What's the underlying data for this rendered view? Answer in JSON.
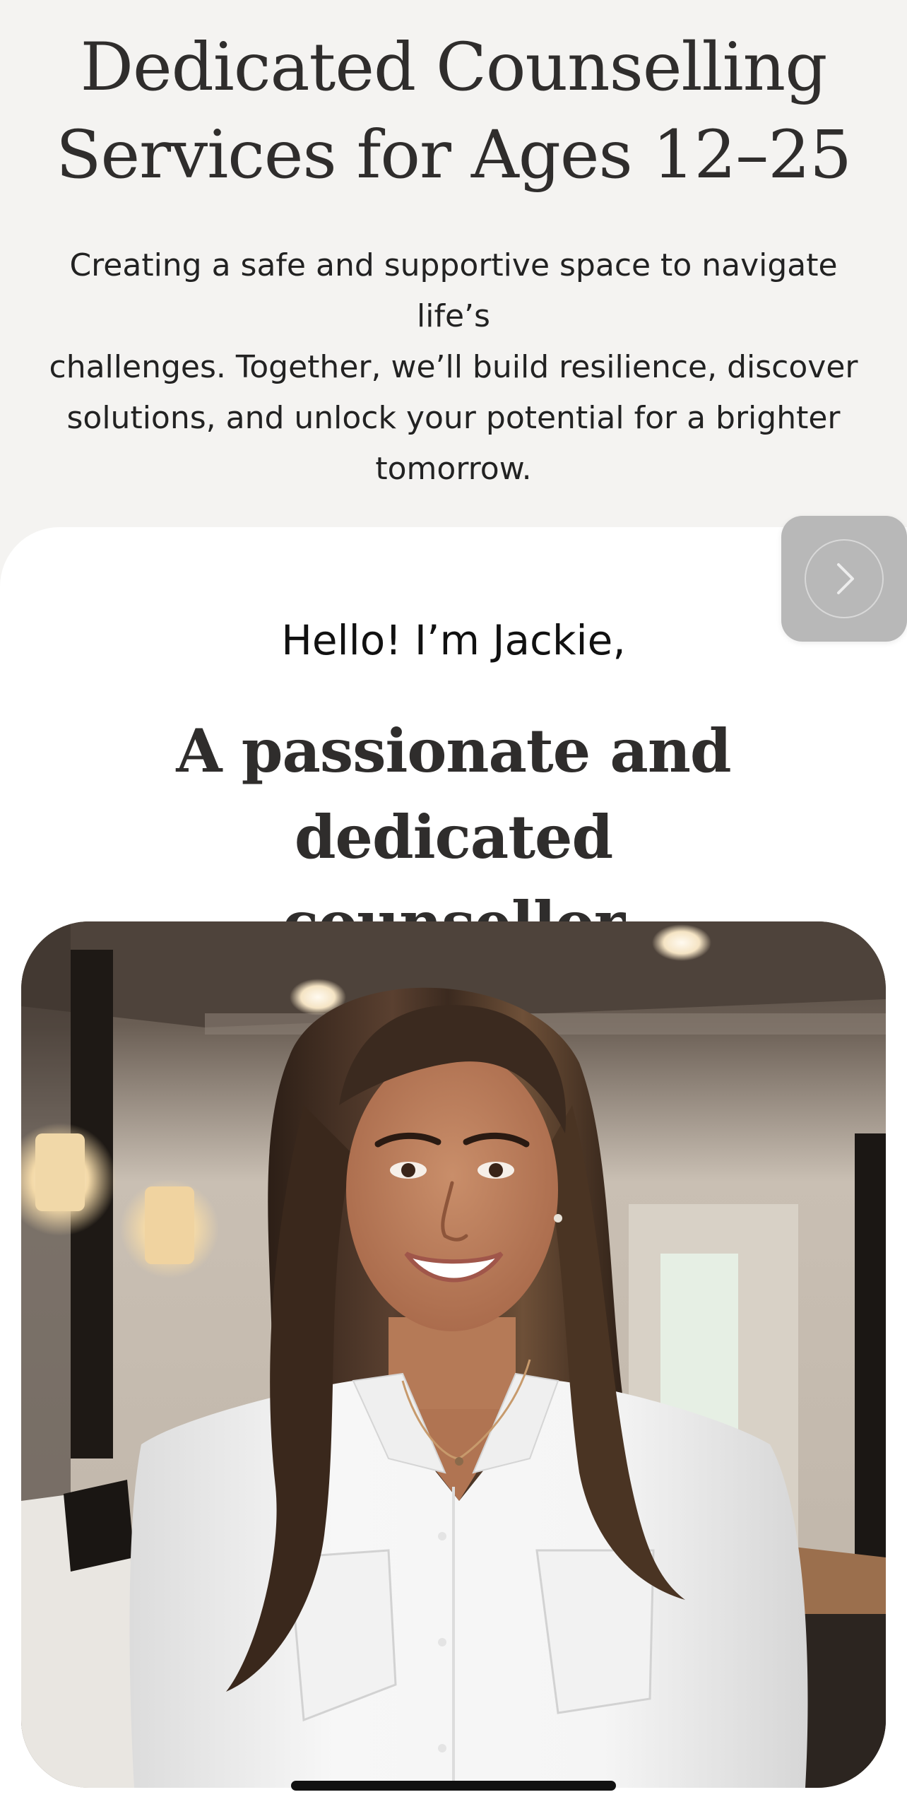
{
  "hero": {
    "title_line1": "Dedicated Counselling",
    "title_line2": "Services for Ages 12–25",
    "subtitle_line1": "Creating a safe and supportive space to navigate life’s",
    "subtitle_line2": "challenges. Together, we’ll build resilience, discover",
    "subtitle_line3": "solutions, and unlock your potential for a brighter",
    "subtitle_line4": "tomorrow."
  },
  "intro": {
    "greeting": "Hello! I’m Jackie,",
    "tagline_line1": "A passionate and dedicated",
    "tagline_line2": "counsellor"
  },
  "next_button": {
    "icon": "chevron-right-icon"
  },
  "portrait": {
    "icon": "counsellor-portrait-photo"
  },
  "colors": {
    "hero_background": "#f4f3f1",
    "card_background": "#ffffff",
    "heading_text": "#2f2d2c",
    "body_text": "#222222",
    "next_button": "#b8b8b8"
  }
}
